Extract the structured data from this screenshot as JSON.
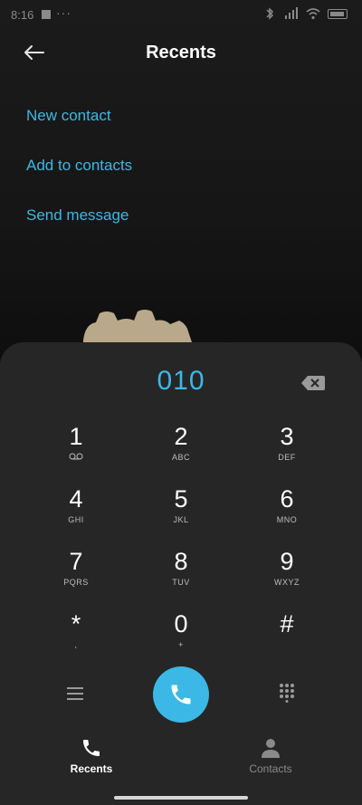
{
  "status_bar": {
    "time": "8:16",
    "dots": "···"
  },
  "header": {
    "title": "Recents"
  },
  "actions": [
    "New contact",
    "Add to contacts",
    "Send message"
  ],
  "dialer": {
    "number": "010",
    "keys": [
      {
        "digit": "1",
        "letters": ""
      },
      {
        "digit": "2",
        "letters": "ABC"
      },
      {
        "digit": "3",
        "letters": "DEF"
      },
      {
        "digit": "4",
        "letters": "GHI"
      },
      {
        "digit": "5",
        "letters": "JKL"
      },
      {
        "digit": "6",
        "letters": "MNO"
      },
      {
        "digit": "7",
        "letters": "PQRS"
      },
      {
        "digit": "8",
        "letters": "TUV"
      },
      {
        "digit": "9",
        "letters": "WXYZ"
      },
      {
        "digit": "*",
        "letters": ","
      },
      {
        "digit": "0",
        "letters": "+"
      },
      {
        "digit": "#",
        "letters": ""
      }
    ]
  },
  "bottom_nav": {
    "recents": "Recents",
    "contacts": "Contacts"
  },
  "colors": {
    "accent": "#3cb8e6",
    "panel": "#262626",
    "background": "#1b1b1b"
  },
  "icons": [
    "back-arrow-icon",
    "backspace-icon",
    "voicemail-icon",
    "menu-icon",
    "phone-icon",
    "keypad-icon",
    "person-icon"
  ]
}
